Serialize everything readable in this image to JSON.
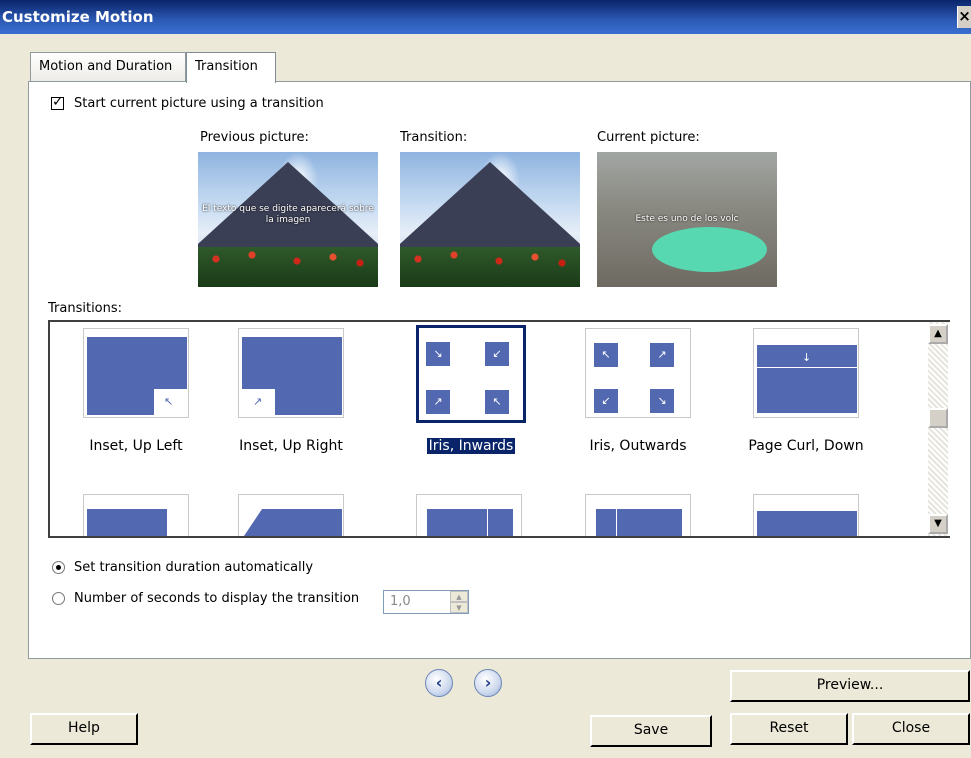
{
  "window": {
    "title": "Customize Motion",
    "close_glyph": "×"
  },
  "tabs": [
    {
      "label": "Motion and Duration",
      "active": false
    },
    {
      "label": "Transition",
      "active": true
    }
  ],
  "start_transition": {
    "label": "Start current picture using a transition",
    "checked": true
  },
  "previews": {
    "previous": {
      "label": "Previous picture:",
      "caption": "El texto que se digite aparecerá sobre la imagen"
    },
    "transition": {
      "label": "Transition:"
    },
    "current": {
      "label": "Current picture:",
      "caption": "Este es uno de los volc"
    }
  },
  "transitions": {
    "label": "Transitions:",
    "items": [
      {
        "label": "Inset, Up Left",
        "icon": "arrow-up-left-icon",
        "glyph": "↖",
        "selected": false
      },
      {
        "label": "Inset, Up Right",
        "icon": "arrow-up-right-icon",
        "glyph": "↗",
        "selected": false
      },
      {
        "label": "Iris, Inwards",
        "icon": "iris-inwards-icon",
        "glyphs": [
          "↘",
          "↙",
          "↗",
          "↖"
        ],
        "selected": true
      },
      {
        "label": "Iris, Outwards",
        "icon": "iris-outwards-icon",
        "glyphs": [
          "↖",
          "↗",
          "↙",
          "↘"
        ],
        "selected": false
      },
      {
        "label": "Page Curl, Down",
        "icon": "arrow-down-icon",
        "glyph": "↓",
        "selected": false
      }
    ],
    "scroll_up": "▲",
    "scroll_down": "▼"
  },
  "duration": {
    "auto_label": "Set transition duration automatically",
    "auto_selected": true,
    "manual_label": "Number of seconds to display the transition",
    "seconds_value": "1,0",
    "spin_up": "▲",
    "spin_down": "▼"
  },
  "nav": {
    "prev_glyph": "‹",
    "next_glyph": "›"
  },
  "buttons": {
    "preview": "Preview...",
    "help": "Help",
    "save": "Save",
    "reset": "Reset",
    "close": "Close"
  },
  "colors": {
    "selection": "#0a246a",
    "thumbnail_blue": "#5268b1",
    "titlebar": "#0a246a"
  }
}
